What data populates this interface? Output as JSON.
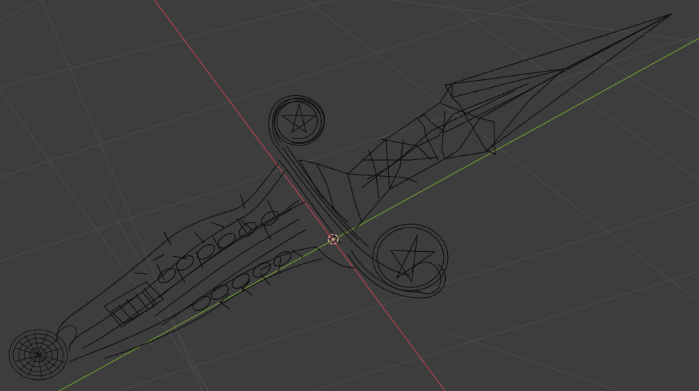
{
  "viewport": {
    "mode": "wireframe",
    "shading": "wireframe",
    "object": "dagger",
    "grid": true,
    "axes_shown": [
      "x",
      "y"
    ]
  },
  "colors": {
    "background": "#3d3d3d",
    "grid_line": "#4b4b4b",
    "x_axis": "#b7434d",
    "y_axis": "#6a9a2e",
    "wire": "#111111",
    "wire_dense": "#1a1a1a",
    "origin_marker": "#f0a0a0"
  },
  "icons": {
    "origin": "origin-marker-icon",
    "pentagram": "pentagram-icon"
  }
}
